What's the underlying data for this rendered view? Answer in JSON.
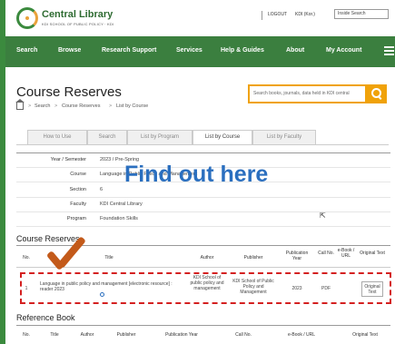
{
  "header": {
    "brand": "Central Library",
    "brand_sub": "KDI  SCHOOL OF PUBLIC POLICY · KDI",
    "logout": "LOGOUT",
    "user": "KDI (Kor.)",
    "search_placeholder": "Inside Search"
  },
  "nav": {
    "items": [
      "Search",
      "Browse",
      "Research Support",
      "Services",
      "Help & Guides",
      "About",
      "My Account"
    ]
  },
  "page": {
    "title": "Course Reserves",
    "breadcrumb": [
      "Search",
      "Course Reserves",
      "List by Course"
    ],
    "search_placeholder": "Search books, journals, data held in KDI central"
  },
  "tabs": [
    "How to Use",
    "Search",
    "List by Program",
    "List by Course",
    "List by Faculty"
  ],
  "active_tab": "List by Course",
  "info": [
    {
      "label": "Year / Semester",
      "value": "2023 / Pre-Spring"
    },
    {
      "label": "Course",
      "value": "Language in Public Policy and Management"
    },
    {
      "label": "Section",
      "value": "6"
    },
    {
      "label": "Faculty",
      "value": "KDI Central Library"
    },
    {
      "label": "Program",
      "value": "Foundation Skills"
    }
  ],
  "overlay_text": "Find out here",
  "reserves": {
    "title": "Course Reserves",
    "headers": {
      "no": "No.",
      "title": "Title",
      "author": "Author",
      "publisher": "Publisher",
      "pub_year": "Publication Year",
      "call_no": "Call No.",
      "ebook": "e-Book / URL",
      "original": "Original Text"
    },
    "rows": [
      {
        "no": "1",
        "title": "Language in public policy and management [electronic resource] : reader 2023",
        "author": "KDI School of public policy and management",
        "publisher": "KDI School of Public Policy and Management",
        "year": "2023",
        "call_no": "PDF",
        "ebook": "",
        "original": "Original Text"
      }
    ]
  },
  "reference": {
    "title": "Reference Book",
    "headers": [
      "No.",
      "Title",
      "Author",
      "Publisher",
      "Publication Year",
      "Call No.",
      "e-Book / URL",
      "Original Text"
    ]
  },
  "colors": {
    "green": "#3b7f3f",
    "orange": "#f0a20a",
    "overlay_blue": "#2b6fbf",
    "highlight_red": "#d42020"
  }
}
